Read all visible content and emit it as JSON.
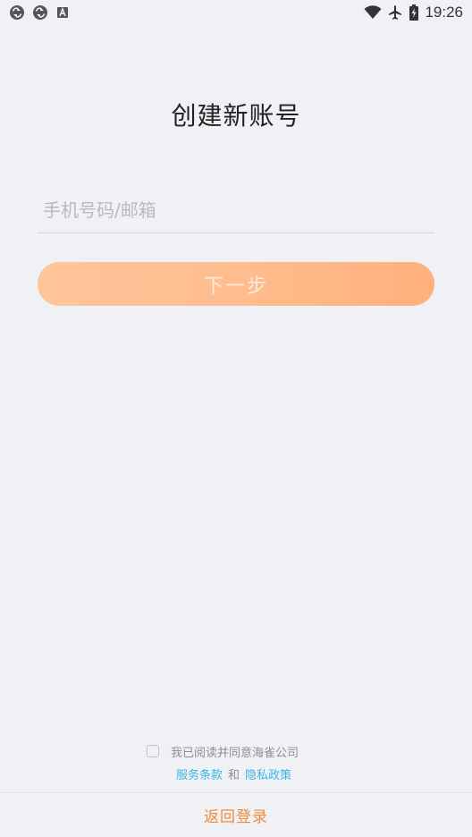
{
  "status_bar": {
    "left_icons": [
      "sync-icon",
      "sync-icon",
      "text-a-icon"
    ],
    "right_icons": [
      "wifi-icon",
      "airplane-icon",
      "battery-charging-icon"
    ],
    "time": "19:26"
  },
  "page": {
    "title": "创建新账号"
  },
  "form": {
    "account_placeholder": "手机号码/邮箱",
    "account_value": "",
    "next_label": "下一步"
  },
  "agreement": {
    "checked": false,
    "text": "我已阅读并同意海雀公司",
    "terms_label": "服务条款",
    "and_label": "和",
    "privacy_label": "隐私政策"
  },
  "footer": {
    "back_label": "返回登录"
  },
  "colors": {
    "background": "#f0f1f5",
    "accent": "#f08a3c",
    "button_gradient_start": "#ffc59a",
    "button_gradient_end": "#ffb07c",
    "link": "#38b6e5"
  }
}
